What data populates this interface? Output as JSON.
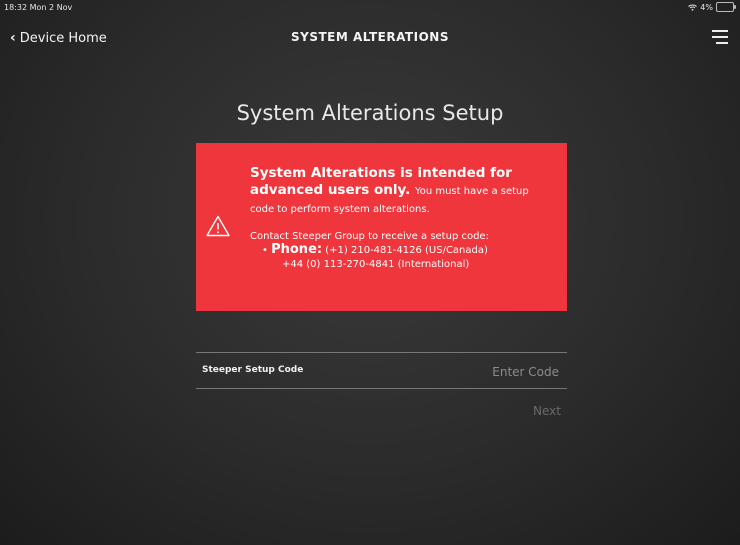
{
  "status_bar": {
    "time": "18:32  Mon 2 Nov",
    "battery": "4%"
  },
  "nav": {
    "back_label": "Device Home",
    "title": "SYSTEM ALTERATIONS"
  },
  "setup_title": "System Alterations Setup",
  "warning": {
    "lead_bold": "System Alterations is intended for advanced users only.",
    "lead_small": "You must have a setup code to perform system alterations.",
    "contact": "Contact Steeper Group to receive a setup code:",
    "phone_bullet": "•",
    "phone_label": "Phone:",
    "phone_us": "(+1) 210-481-4126 (US/Canada)",
    "phone_intl": "+44 (0) 113-270-4841 (International)"
  },
  "code_field": {
    "label": "Steeper Setup Code",
    "placeholder": "Enter Code"
  },
  "next_label": "Next",
  "colors": {
    "warning_bg": "#f0363d",
    "background": "#2b2b2b"
  }
}
